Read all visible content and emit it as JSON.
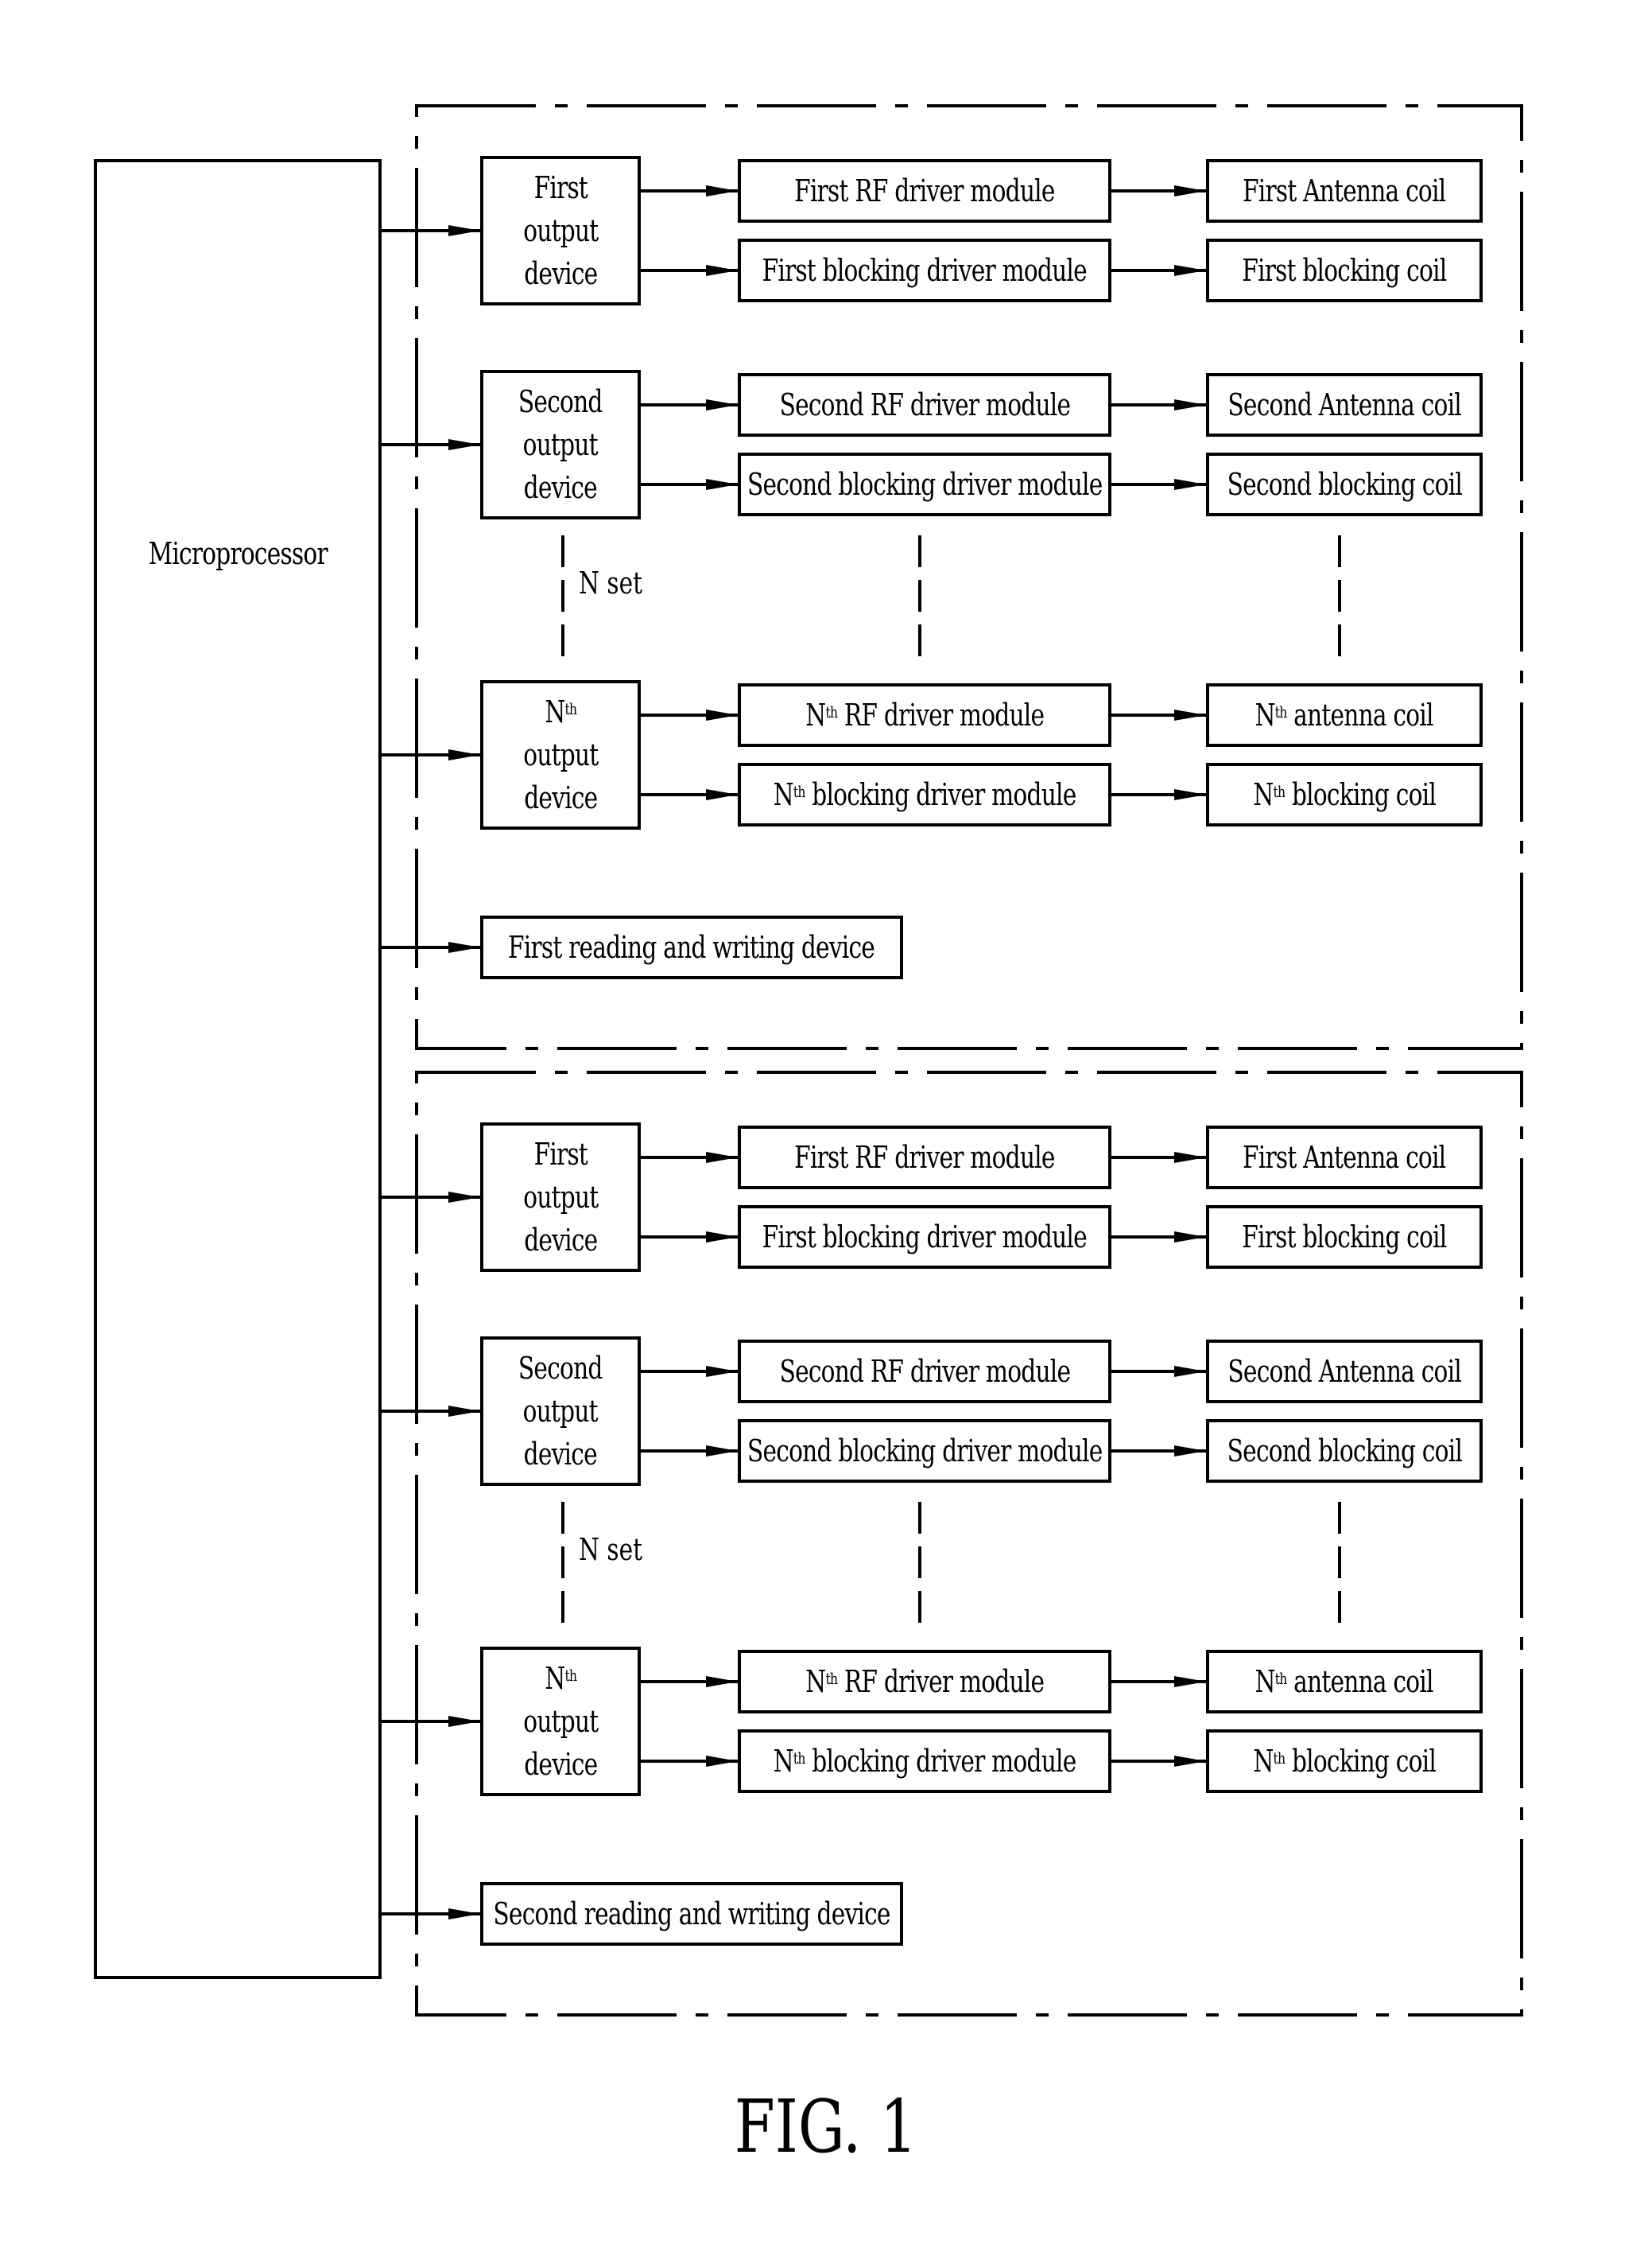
{
  "microprocessor": {
    "label": "Microprocessor"
  },
  "groups": [
    {
      "name": "upper",
      "channels": [
        {
          "output_device": [
            "First",
            "output",
            "device"
          ],
          "rf_module": "First RF driver module",
          "antenna_coil": "First Antenna coil",
          "blocking_module": "First blocking driver module",
          "blocking_coil": "First blocking coil"
        },
        {
          "output_device": [
            "Second",
            "output",
            "device"
          ],
          "rf_module": "Second RF driver module",
          "antenna_coil": "Second Antenna coil",
          "blocking_module": "Second blocking driver module",
          "blocking_coil": "Second blocking coil"
        },
        {
          "output_device": [
            "N",
            "output",
            "device"
          ],
          "nth": true,
          "sup": "th",
          "rf_module": "RF driver module",
          "antenna_coil": "antenna coil",
          "blocking_module": "blocking driver module",
          "blocking_coil": "blocking coil"
        }
      ],
      "n_set_label": "N set",
      "reading_writing_device": "First reading and writing device"
    },
    {
      "name": "lower",
      "channels": [
        {
          "output_device": [
            "First",
            "output",
            "device"
          ],
          "rf_module": "First RF driver module",
          "antenna_coil": "First Antenna coil",
          "blocking_module": "First blocking driver module",
          "blocking_coil": "First blocking coil"
        },
        {
          "output_device": [
            "Second",
            "output",
            "device"
          ],
          "rf_module": "Second RF driver module",
          "antenna_coil": "Second Antenna coil",
          "blocking_module": "Second blocking driver module",
          "blocking_coil": "Second blocking coil"
        },
        {
          "output_device": [
            "N",
            "output",
            "device"
          ],
          "nth": true,
          "sup": "th",
          "rf_module": "RF driver module",
          "antenna_coil": "antenna coil",
          "blocking_module": "blocking driver module",
          "blocking_coil": "blocking coil"
        }
      ],
      "n_set_label": "N set",
      "reading_writing_device": "Second reading and writing device"
    }
  ],
  "figure_label": "FIG. 1"
}
